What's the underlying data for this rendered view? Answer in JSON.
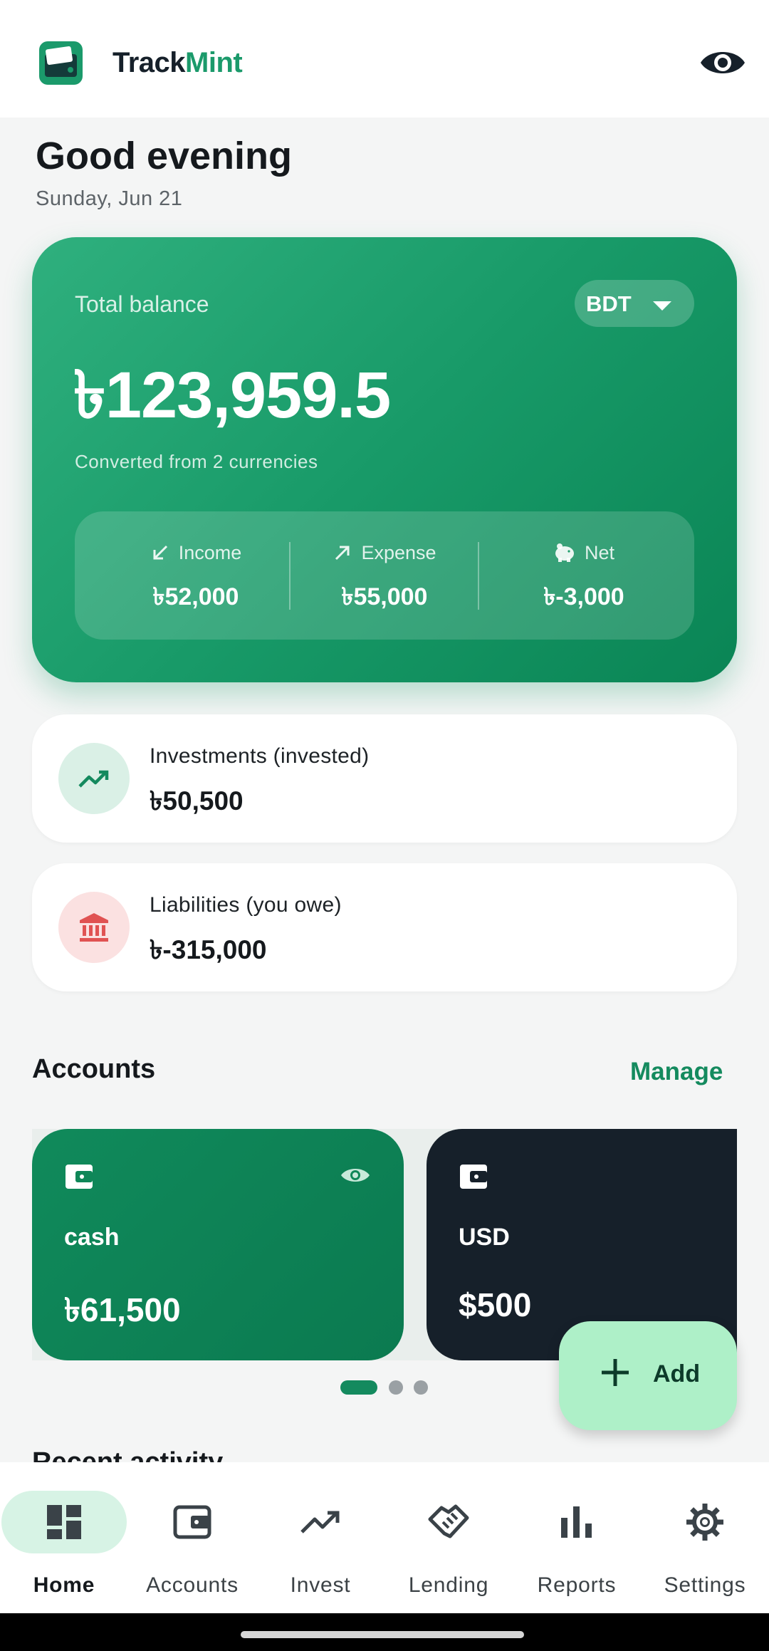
{
  "app": {
    "name_part1": "Track",
    "name_part2": "Mint"
  },
  "header": {
    "greeting": "Good evening",
    "date": "Sunday, Jun 21"
  },
  "balance": {
    "label": "Total balance",
    "currency": "BDT",
    "amount": "৳123,959.5",
    "converted_note": "Converted from 2 currencies",
    "income_label": "Income",
    "income_value": "৳52,000",
    "expense_label": "Expense",
    "expense_value": "৳55,000",
    "net_label": "Net",
    "net_value": "৳-3,000"
  },
  "investments": {
    "label": "Investments (invested)",
    "value": "৳50,500"
  },
  "liabilities": {
    "label": "Liabilities (you owe)",
    "value": "৳-315,000"
  },
  "accounts": {
    "title": "Accounts",
    "manage_label": "Manage",
    "items": [
      {
        "name": "cash",
        "balance": "৳61,500"
      },
      {
        "name": "USD",
        "balance": "$500"
      }
    ]
  },
  "fab": {
    "label": "Add"
  },
  "next_section_title": "Recent activity",
  "nav": {
    "items": [
      {
        "label": "Home",
        "icon": "dashboard-icon"
      },
      {
        "label": "Accounts",
        "icon": "wallet-icon"
      },
      {
        "label": "Invest",
        "icon": "trending-up-icon"
      },
      {
        "label": "Lending",
        "icon": "handshake-icon"
      },
      {
        "label": "Reports",
        "icon": "bar-chart-icon"
      },
      {
        "label": "Settings",
        "icon": "gear-icon"
      }
    ]
  },
  "colors": {
    "brand": "#1b9a6b",
    "card_gradient_start": "#2fb07e",
    "card_gradient_end": "#0a8555",
    "usd_card": "#16202a",
    "fab": "#aef0c8",
    "liability_accent": "#e05252"
  }
}
